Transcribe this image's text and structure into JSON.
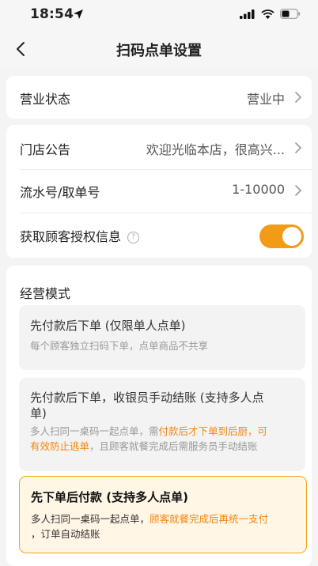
{
  "status": {
    "time": "18:54"
  },
  "nav": {
    "title": "扫码点单设置"
  },
  "settings": {
    "business_status": {
      "label": "营业状态",
      "value": "营业中"
    },
    "notice": {
      "label": "门店公告",
      "value": "欢迎光临本店，很高兴..."
    },
    "serial": {
      "label": "流水号/取单号",
      "value": "1-10000"
    },
    "authorize": {
      "label": "获取顾客授权信息",
      "enabled": true
    }
  },
  "mode": {
    "title": "经营模式",
    "options": [
      {
        "title": "先付款后下单 (仅限单人点单)",
        "desc": "每个顾客独立扫码下单，点单商品不共享",
        "selected": false
      },
      {
        "title_line1": "先付款后下单，收银员手动结账 (支持多人点",
        "title_line2": "单)",
        "desc_a": "多人扫同一桌码一起点单，需",
        "desc_hl": "付款后才下单到后厨，可",
        "desc_hl2": "有效防止逃单",
        "desc_b": "，且顾客就餐完成后需服务员手动结账",
        "selected": false
      },
      {
        "title": "先下单后付款 (支持多人点单)",
        "desc_a": "多人扫同一桌码一起点单，",
        "desc_hl": "顾客就餐完成后再统一支付",
        "desc_b": "，订单自动结账",
        "selected": true
      }
    ]
  },
  "colors": {
    "accent": "#f19b16",
    "highlight": "#f3850f"
  }
}
